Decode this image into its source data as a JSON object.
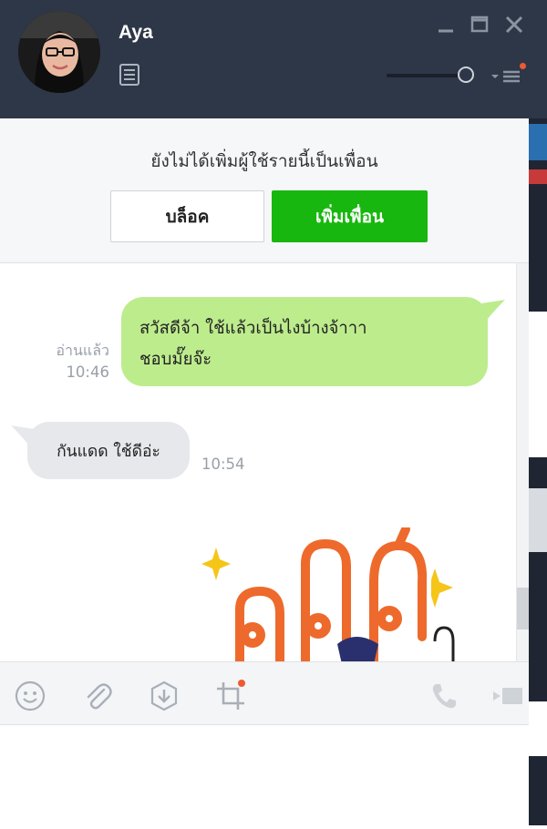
{
  "contact": {
    "name": "Aya"
  },
  "banner": {
    "message": "ยังไม่ได้เพิ่มผู้ใช้รายนี้เป็นเพื่อน",
    "block_label": "บล็อค",
    "add_friend_label": "เพิ่มเพื่อน"
  },
  "messages": [
    {
      "direction": "outgoing",
      "lines": [
        "สวัสดีจ้า ใช้แล้วเป็นไงบ้างจ้าาา",
        "ชอบมั๊ยจ๊ะ"
      ],
      "read_status": "อ่านแล้ว",
      "time": "10:46"
    },
    {
      "direction": "incoming",
      "text": "กันแดด ใช้ดีอ่ะ",
      "time": "10:54"
    }
  ],
  "sticker": {
    "icon": "sticker-image",
    "text": "ปลิศ"
  },
  "toolbar": {
    "icons": [
      "emoji-icon",
      "attachment-icon",
      "keep-icon",
      "crop-icon",
      "phone-icon",
      "video-icon"
    ]
  },
  "input": {
    "placeholder": ""
  },
  "colors": {
    "header_bg": "#2e3748",
    "add_friend_green": "#18b70f",
    "outgoing_bubble": "#bdec8d",
    "incoming_bubble": "#e6e8eb",
    "notification_dot": "#ef5a31"
  }
}
